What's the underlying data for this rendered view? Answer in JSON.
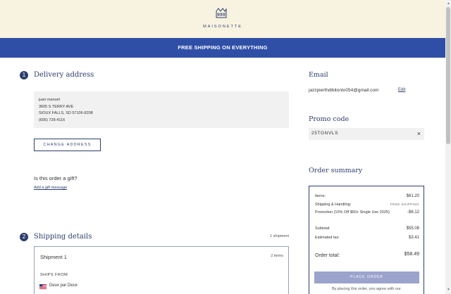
{
  "header": {
    "logo_text": "MAISONETTE",
    "banner": "FREE SHIPPING ON EVERYTHING"
  },
  "delivery": {
    "step": "1",
    "title": "Delivery address",
    "address_lines": [
      "juan manuel",
      "3605 S TERRY AVE",
      "SIOUX FALLS, SD 57106-8208",
      "(605) 728-4116"
    ],
    "change_label": "CHANGE ADDRESS",
    "gift_question": "Is this order a gift?",
    "gift_link": "Add a gift message"
  },
  "shipping": {
    "step": "2",
    "title": "Shipping details",
    "count": "1 shipment",
    "shipment_title": "Shipment 1",
    "items": "2 items",
    "ships_from_label": "SHIPS FROM",
    "vendor": "Deux par Deux"
  },
  "email": {
    "title": "Email",
    "value": "jazzpierthdibitonto054@gmail.com",
    "edit_label": "Edit"
  },
  "promo": {
    "title": "Promo code",
    "value": "25TGNVLS",
    "remove_label": "×"
  },
  "summary": {
    "title": "Order summary",
    "rows": [
      {
        "label": "Items:",
        "value": "$61.20"
      },
      {
        "label": "Shipping & Handling:",
        "value": "FREE SHIPPING"
      },
      {
        "label": "Promotion (10% Off $50+ Single Use 2025)",
        "value": "-$6.12"
      },
      {
        "label": "Subtotal:",
        "value": "$55.08"
      },
      {
        "label": "Estimated tax:",
        "value": "$3.41"
      }
    ],
    "total_label": "Order total:",
    "total_value": "$58.49",
    "place_order_label": "PLACE ORDER",
    "terms": "By placing this order, you agree with our"
  },
  "colors": {
    "banner": "#2f4fa7",
    "header_bg": "#f8f3e1",
    "accent": "#2c3e6b",
    "button_disabled": "#9aa4cc"
  }
}
